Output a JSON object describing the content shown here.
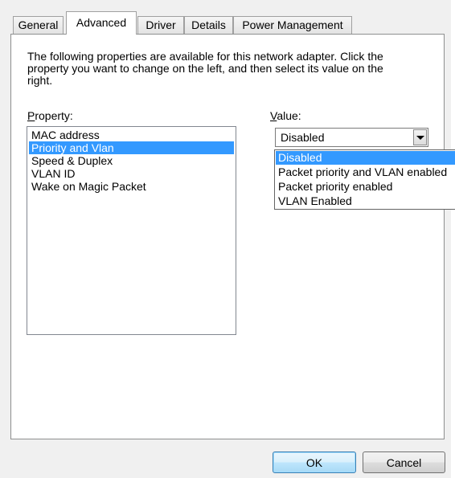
{
  "tabs": [
    {
      "label": "General"
    },
    {
      "label": "Advanced",
      "active": true
    },
    {
      "label": "Driver"
    },
    {
      "label": "Details"
    },
    {
      "label": "Power Management"
    }
  ],
  "description": "The following properties are available for this network adapter. Click the property you want to change on the left, and then select its value on the right.",
  "property": {
    "label": "Property:",
    "items": [
      "MAC address",
      "Priority and Vlan",
      "Speed & Duplex",
      "VLAN ID",
      "Wake on Magic Packet"
    ],
    "selected": "Priority and Vlan"
  },
  "value": {
    "label": "Value:",
    "selected": "Disabled",
    "options": [
      "Disabled",
      "Packet priority and VLAN enabled",
      "Packet priority enabled",
      "VLAN Enabled"
    ]
  },
  "buttons": {
    "ok": "OK",
    "cancel": "Cancel"
  },
  "colors": {
    "selection": "#3399ff",
    "dialog_background": "#f0f0f0"
  }
}
